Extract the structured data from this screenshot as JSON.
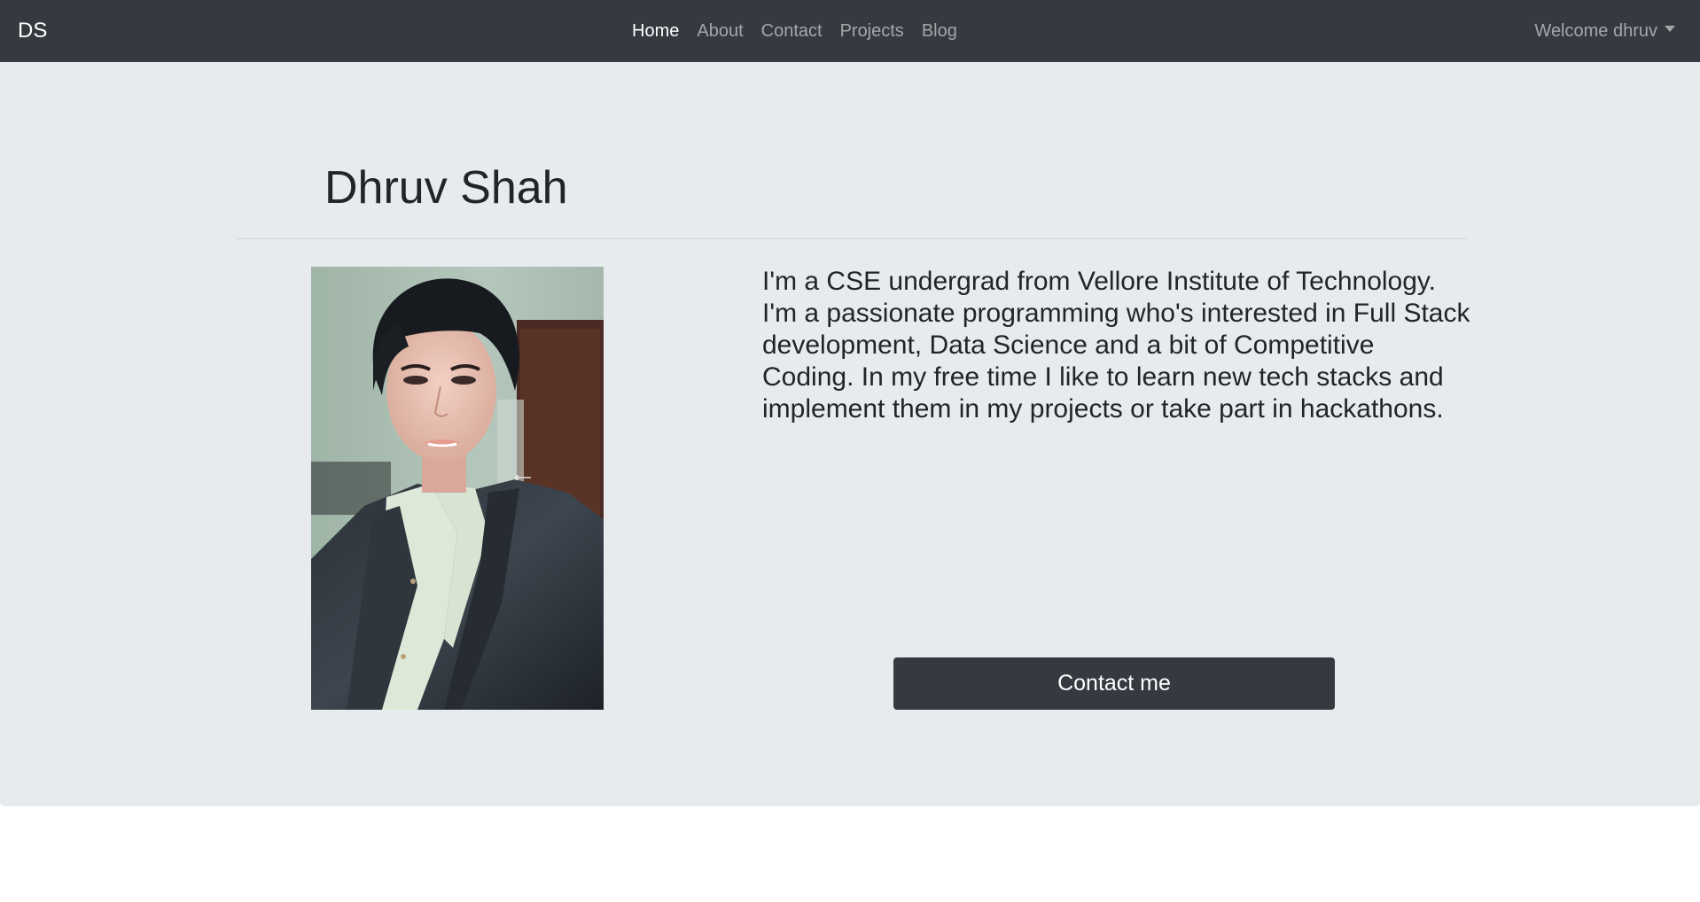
{
  "navbar": {
    "brand": "DS",
    "links": [
      {
        "label": "Home",
        "active": true
      },
      {
        "label": "About",
        "active": false
      },
      {
        "label": "Contact",
        "active": false
      },
      {
        "label": "Projects",
        "active": false
      },
      {
        "label": "Blog",
        "active": false
      }
    ],
    "user_menu_label": "Welcome dhruv"
  },
  "hero": {
    "name": "Dhruv Shah",
    "bio": "I'm a CSE undergrad from Vellore Institute of Technology. I'm a passionate programming who's interested in Full Stack development, Data Science and a bit of Competitive Coding. In my free time I like to learn new tech stacks and implement them in my projects or take part in hackathons.",
    "contact_button_label": "Contact me"
  },
  "colors": {
    "navbar_bg": "#343a40",
    "jumbotron_bg": "#e8ebee",
    "button_bg": "#343a40"
  }
}
